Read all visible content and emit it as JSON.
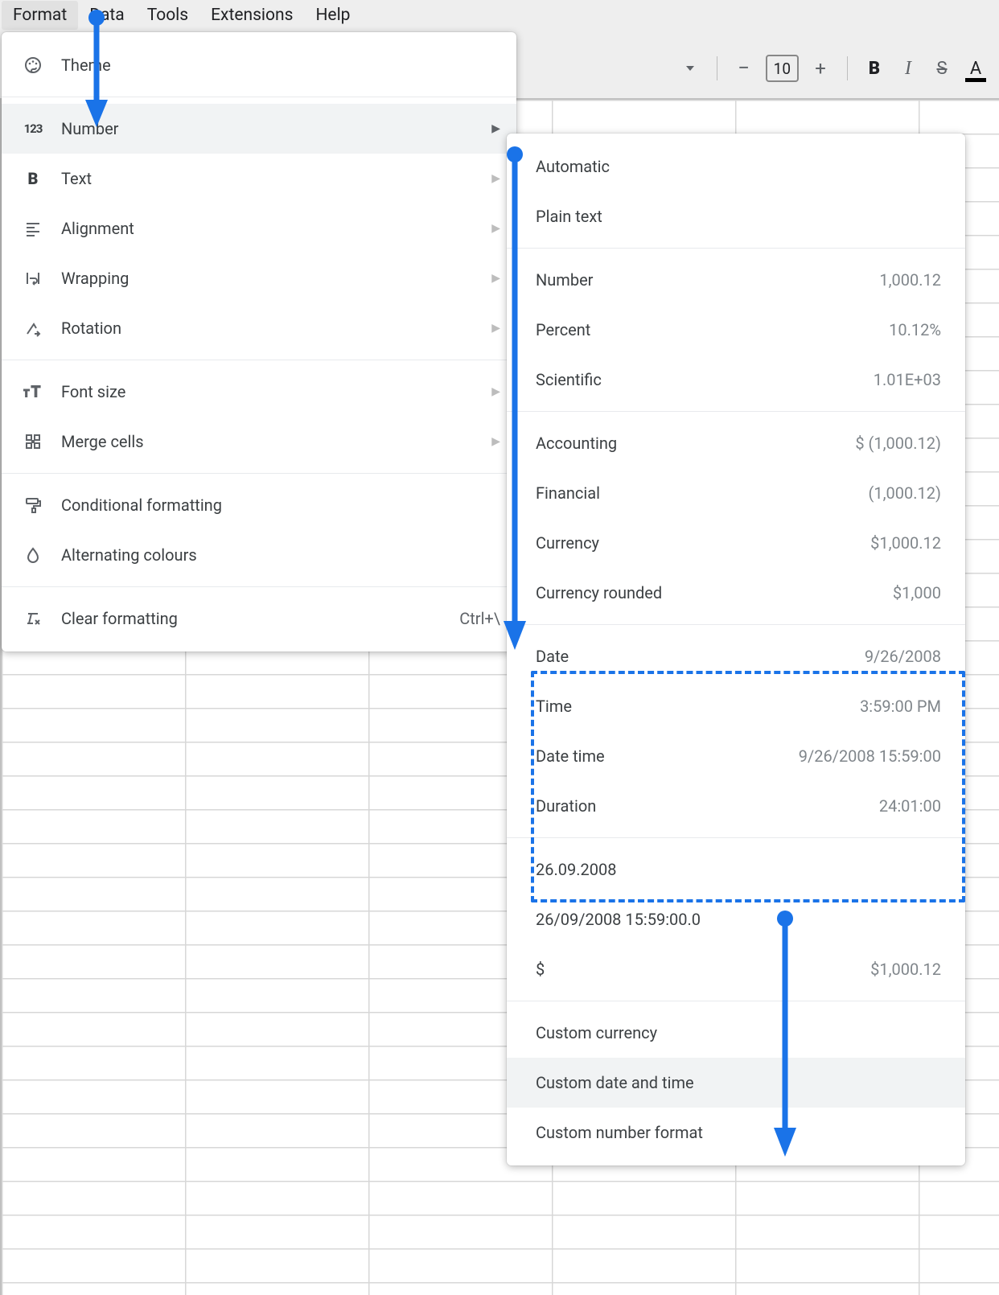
{
  "menubar": {
    "format": "Format",
    "data": "Data",
    "tools": "Tools",
    "extensions": "Extensions",
    "help": "Help"
  },
  "toolbar": {
    "font_size_value": "10"
  },
  "format_menu": {
    "theme": "Theme",
    "number": "Number",
    "text": "Text",
    "alignment": "Alignment",
    "wrapping": "Wrapping",
    "rotation": "Rotation",
    "font_size": "Font size",
    "merge_cells": "Merge cells",
    "conditional_formatting": "Conditional formatting",
    "alternating_colours": "Alternating colours",
    "clear_formatting": "Clear formatting",
    "clear_formatting_shortcut": "Ctrl+\\"
  },
  "number_menu": {
    "automatic": "Automatic",
    "plain_text": "Plain text",
    "number_lbl": "Number",
    "number_ex": "1,000.12",
    "percent_lbl": "Percent",
    "percent_ex": "10.12%",
    "scientific_lbl": "Scientific",
    "scientific_ex": "1.01E+03",
    "accounting_lbl": "Accounting",
    "accounting_ex": "$ (1,000.12)",
    "financial_lbl": "Financial",
    "financial_ex": "(1,000.12)",
    "currency_lbl": "Currency",
    "currency_ex": "$1,000.12",
    "currency_rounded_lbl": "Currency rounded",
    "currency_rounded_ex": "$1,000",
    "date_lbl": "Date",
    "date_ex": "9/26/2008",
    "time_lbl": "Time",
    "time_ex": "3:59:00 PM",
    "datetime_lbl": "Date time",
    "datetime_ex": "9/26/2008 15:59:00",
    "duration_lbl": "Duration",
    "duration_ex": "24:01:00",
    "recent1": "26.09.2008",
    "recent2": "26/09/2008 15:59:00.0",
    "recent3_lbl": "$",
    "recent3_ex": "$1,000.12",
    "custom_currency": "Custom currency",
    "custom_datetime": "Custom date and time",
    "custom_number": "Custom number format"
  }
}
